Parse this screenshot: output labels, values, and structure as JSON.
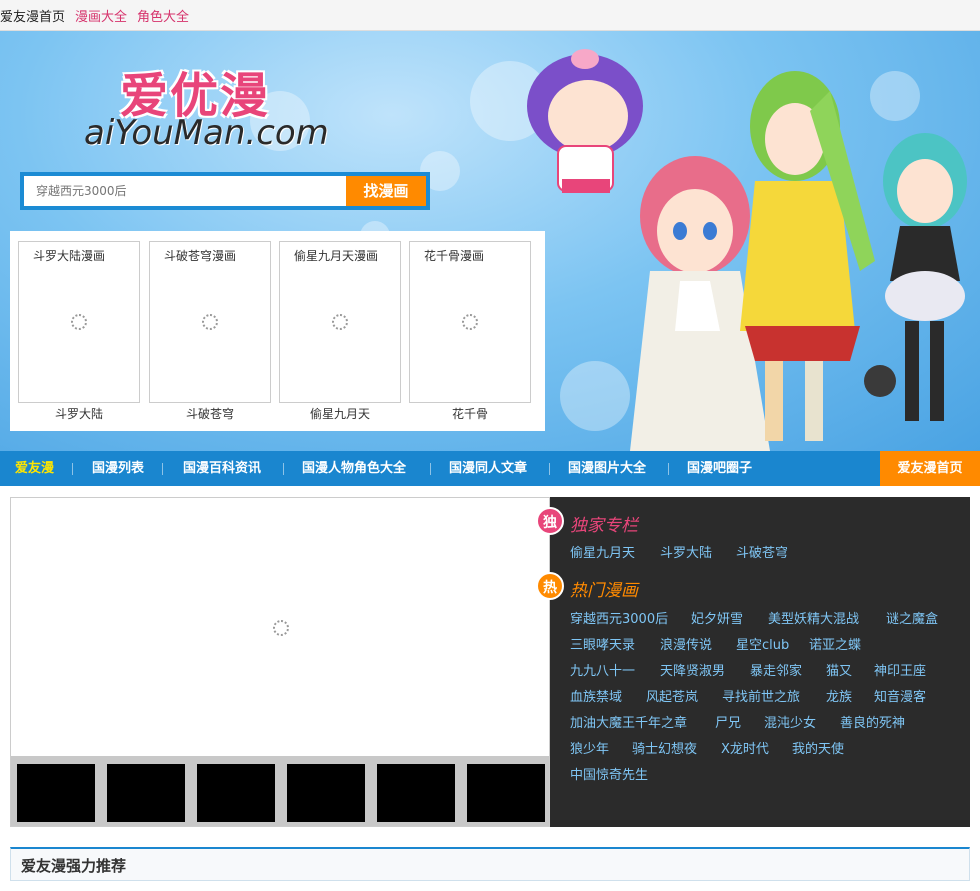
{
  "topbar": {
    "links": [
      {
        "label": "爱友漫首页",
        "color": "#222222"
      },
      {
        "label": "漫画大全",
        "color": "#d6336c"
      },
      {
        "label": "角色大全",
        "color": "#d6336c"
      }
    ]
  },
  "logo": {
    "cn": "爱优漫",
    "en": "aiYouMan.com"
  },
  "search": {
    "placeholder": "穿越西元3000后",
    "button": "找漫画"
  },
  "featured": [
    {
      "title": "斗罗大陆漫画",
      "caption": "斗罗大陆"
    },
    {
      "title": "斗破苍穹漫画",
      "caption": "斗破苍穹"
    },
    {
      "title": "偷星九月天漫画",
      "caption": "偷星九月天"
    },
    {
      "title": "花千骨漫画",
      "caption": "花千骨"
    }
  ],
  "nav": {
    "items": [
      "爱友漫",
      "国漫列表",
      "国漫百科资讯",
      "国漫人物角色大全",
      "国漫同人文章",
      "国漫图片大全",
      "国漫吧圈子"
    ],
    "home": "爱友漫首页"
  },
  "panel": {
    "exclusive": {
      "badge": "独",
      "title": "独家专栏",
      "color": "#e8457a",
      "links": [
        "偷星九月天",
        "斗罗大陆",
        "斗破苍穹"
      ]
    },
    "hot": {
      "badge": "热",
      "title": "热门漫画",
      "color": "#ff8a00",
      "rows": [
        [
          "穿越西元3000后",
          "妃夕妍雪",
          "美型妖精大混战",
          "谜之魔盒"
        ],
        [
          "三眼哮天录",
          "浪漫传说",
          "星空club",
          "诺亚之蝶"
        ],
        [
          "九九八十一",
          "天降贤淑男",
          "暴走邻家",
          "猫又",
          "神印王座"
        ],
        [
          "血族禁域",
          "风起苍岚",
          "寻找前世之旅",
          "龙族",
          "知音漫客"
        ],
        [
          "加油大魔王千年之章",
          "尸兄",
          "混沌少女",
          "善良的死神"
        ],
        [
          "狼少年",
          "骑士幻想夜",
          "X龙时代",
          "我的天使"
        ],
        [
          "中国惊奇先生"
        ]
      ]
    }
  },
  "recommend": {
    "title": "爱友漫强力推荐"
  }
}
